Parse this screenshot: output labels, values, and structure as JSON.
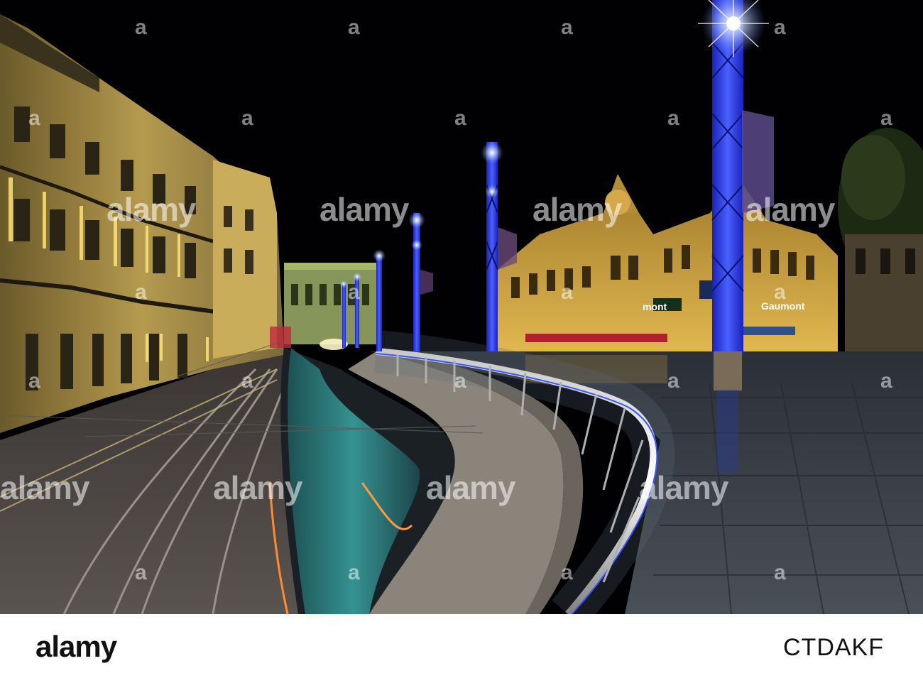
{
  "scene": {
    "description_name": "night tram square photo",
    "signs": {
      "gaumont_left": "mont",
      "gaumont_right": "Gaumont"
    }
  },
  "watermark": {
    "text": "alamy",
    "letter": "a"
  },
  "footer": {
    "logo": "alamy",
    "image_id": "CTDAKF"
  },
  "colors": {
    "sky": "#000000",
    "pole_blue": "#2a3cff",
    "building_gold": "#c9a64a",
    "pavement": "#3a4048"
  }
}
